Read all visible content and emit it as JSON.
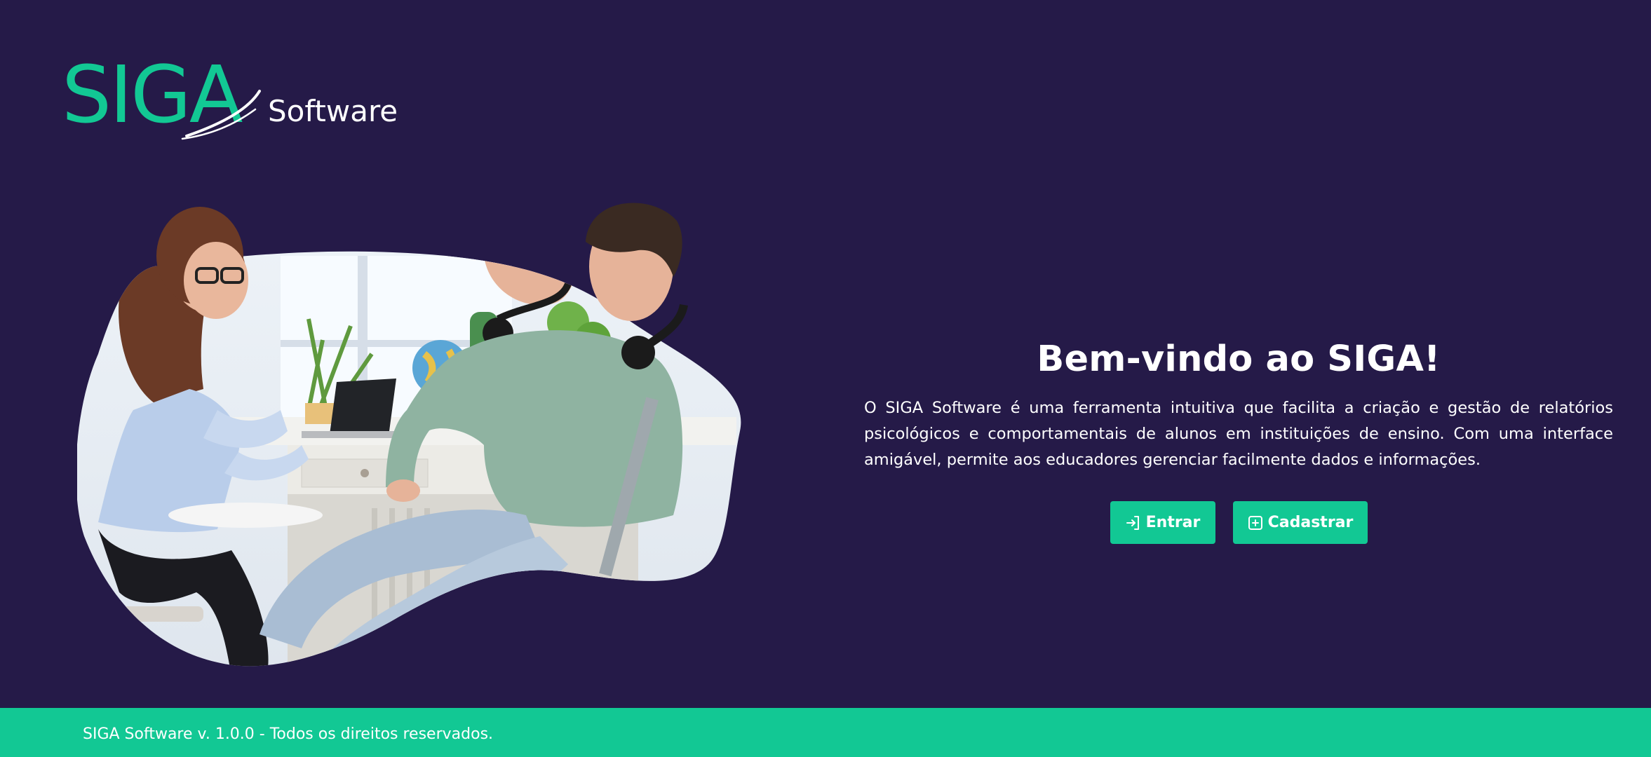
{
  "colors": {
    "background": "#251a48",
    "accent": "#12c894",
    "text": "#ffffff"
  },
  "logo": {
    "brand": "SIGA",
    "sub": "Software"
  },
  "hero": {
    "icon": "counseling-session-photo"
  },
  "welcome": {
    "title": "Bem-vindo ao SIGA!",
    "description": "O SIGA Software é uma ferramenta intuitiva que facilita a criação e gestão de relatórios psicológicos e comportamentais de alunos em instituições de ensino. Com uma interface amigável, permite aos educadores gerenciar facilmente dados e informações."
  },
  "actions": {
    "login_label": "Entrar",
    "login_icon": "login-icon",
    "register_label": "Cadastrar",
    "register_icon": "plus-square-icon"
  },
  "footer": {
    "text": "SIGA Software v. 1.0.0 - Todos os direitos reservados."
  }
}
